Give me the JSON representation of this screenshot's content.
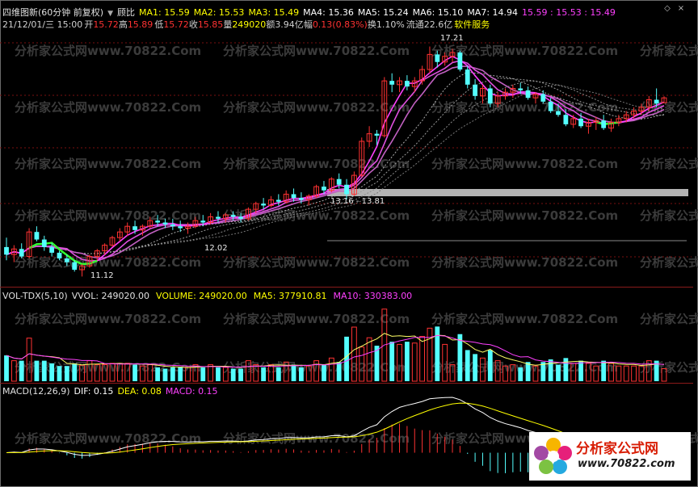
{
  "top_bar": {
    "title": "四维图新(60分钟 前复权)",
    "menu_label": "▼",
    "indicator_name": "顾比",
    "ma": [
      {
        "label": "MA1: 15.59",
        "color": "#ffff00"
      },
      {
        "label": "MA2: 15.53",
        "color": "#ffff00"
      },
      {
        "label": "MA3: 15.49",
        "color": "#ffff00"
      },
      {
        "label": "MA4: 15.36",
        "color": "#ffffff"
      },
      {
        "label": "MA5: 15.24",
        "color": "#ffffff"
      },
      {
        "label": "MA6: 15.10",
        "color": "#ffffff"
      },
      {
        "label": "MA7: 14.94",
        "color": "#ffffff"
      }
    ],
    "extra": "15.59 : 15.53 : 15.49",
    "extra_color": "#ff40ff"
  },
  "quote_bar": {
    "datetime": "21/12/01/三 15:00",
    "open_label": "开",
    "open": "15.72",
    "high_label": "高",
    "high": "15.89",
    "low_label": "低",
    "low": "15.72",
    "close_label": "收",
    "close": "15.85",
    "volume_label": "量",
    "volume": "249020",
    "amount_label": "额",
    "amount": "3.94亿",
    "change_label": "幅",
    "change": "0.13(0.83%)",
    "turnover_label": "换",
    "turnover": "1.10%",
    "float_label": "流通",
    "float": "22.6亿",
    "sector": "软件服务"
  },
  "price_labels": {
    "high_mark": "17.21",
    "mid_mark": "13.16 - 13.81",
    "low_mark": "11.12",
    "partial_mark": "12.02"
  },
  "volume_panel": {
    "name": "VOL-TDX(5,10)",
    "vvol": "VVOL: 249020.00",
    "volume": "VOLUME: 249020.00",
    "ma5": "MA5: 377910.81",
    "ma10": "MA10: 330383.00"
  },
  "macd_panel": {
    "name": "MACD(12,26,9)",
    "dif": "DIF: 0.15",
    "dea": "DEA: 0.08",
    "macd": "MACD: 0.15"
  },
  "watermark": "分析家公式网www.70822.Com",
  "logo": {
    "name": "分析家公式网",
    "url": "www.70822.com"
  },
  "colors": {
    "up": "#ff3232",
    "down": "#54ffff",
    "ma_short": "#ff40ff",
    "ma_long": "#d8d8d8",
    "dif": "#ffffff",
    "dea": "#ffff00",
    "highlight_band": "#b4b4b4"
  },
  "chart_data": {
    "type": "candlestick",
    "price_axis_note": "no printed axis",
    "candles": [
      {
        "o": 11.9,
        "h": 12.15,
        "l": 11.55,
        "c": 11.7
      },
      {
        "o": 11.7,
        "h": 11.95,
        "l": 11.5,
        "c": 11.85
      },
      {
        "o": 11.85,
        "h": 12.0,
        "l": 11.6,
        "c": 11.65
      },
      {
        "o": 11.65,
        "h": 12.4,
        "l": 11.6,
        "c": 12.3
      },
      {
        "o": 12.3,
        "h": 12.45,
        "l": 12.05,
        "c": 12.1
      },
      {
        "o": 12.1,
        "h": 12.2,
        "l": 11.8,
        "c": 11.9
      },
      {
        "o": 11.9,
        "h": 12.0,
        "l": 11.65,
        "c": 11.75
      },
      {
        "o": 11.75,
        "h": 11.8,
        "l": 11.55,
        "c": 11.6
      },
      {
        "o": 11.6,
        "h": 11.7,
        "l": 11.4,
        "c": 11.5
      },
      {
        "o": 11.5,
        "h": 11.55,
        "l": 11.25,
        "c": 11.3
      },
      {
        "o": 11.3,
        "h": 11.45,
        "l": 11.12,
        "c": 11.4
      },
      {
        "o": 11.4,
        "h": 11.7,
        "l": 11.35,
        "c": 11.65
      },
      {
        "o": 11.65,
        "h": 11.85,
        "l": 11.55,
        "c": 11.8
      },
      {
        "o": 11.8,
        "h": 12.0,
        "l": 11.7,
        "c": 11.95
      },
      {
        "o": 11.95,
        "h": 12.2,
        "l": 11.9,
        "c": 12.15
      },
      {
        "o": 12.15,
        "h": 12.4,
        "l": 12.05,
        "c": 12.3
      },
      {
        "o": 12.3,
        "h": 12.55,
        "l": 12.2,
        "c": 12.45
      },
      {
        "o": 12.45,
        "h": 12.6,
        "l": 12.25,
        "c": 12.35
      },
      {
        "o": 12.35,
        "h": 12.5,
        "l": 12.2,
        "c": 12.45
      },
      {
        "o": 12.45,
        "h": 12.7,
        "l": 12.4,
        "c": 12.6
      },
      {
        "o": 12.6,
        "h": 12.75,
        "l": 12.45,
        "c": 12.55
      },
      {
        "o": 12.55,
        "h": 12.65,
        "l": 12.4,
        "c": 12.5
      },
      {
        "o": 12.5,
        "h": 12.65,
        "l": 12.35,
        "c": 12.45
      },
      {
        "o": 12.45,
        "h": 12.6,
        "l": 12.3,
        "c": 12.4
      },
      {
        "o": 12.4,
        "h": 12.55,
        "l": 12.25,
        "c": 12.45
      },
      {
        "o": 12.45,
        "h": 12.7,
        "l": 12.4,
        "c": 12.6
      },
      {
        "o": 12.6,
        "h": 12.75,
        "l": 12.45,
        "c": 12.55
      },
      {
        "o": 12.55,
        "h": 12.8,
        "l": 12.5,
        "c": 12.7
      },
      {
        "o": 12.7,
        "h": 12.85,
        "l": 12.55,
        "c": 12.65
      },
      {
        "o": 12.65,
        "h": 12.8,
        "l": 12.55,
        "c": 12.75
      },
      {
        "o": 12.75,
        "h": 12.85,
        "l": 12.6,
        "c": 12.7
      },
      {
        "o": 12.7,
        "h": 12.8,
        "l": 12.55,
        "c": 12.65
      },
      {
        "o": 12.65,
        "h": 12.95,
        "l": 12.6,
        "c": 12.9
      },
      {
        "o": 12.9,
        "h": 13.1,
        "l": 12.8,
        "c": 13.05
      },
      {
        "o": 13.05,
        "h": 13.2,
        "l": 12.9,
        "c": 13.0
      },
      {
        "o": 13.0,
        "h": 13.25,
        "l": 12.95,
        "c": 13.15
      },
      {
        "o": 13.15,
        "h": 13.3,
        "l": 13.0,
        "c": 13.1
      },
      {
        "o": 13.1,
        "h": 13.4,
        "l": 13.05,
        "c": 13.3
      },
      {
        "o": 13.3,
        "h": 13.45,
        "l": 13.1,
        "c": 13.2
      },
      {
        "o": 13.2,
        "h": 13.35,
        "l": 13.05,
        "c": 13.15
      },
      {
        "o": 13.15,
        "h": 13.3,
        "l": 13.0,
        "c": 13.25
      },
      {
        "o": 13.25,
        "h": 13.55,
        "l": 13.2,
        "c": 13.5
      },
      {
        "o": 13.5,
        "h": 13.65,
        "l": 13.3,
        "c": 13.4
      },
      {
        "o": 13.4,
        "h": 13.75,
        "l": 13.35,
        "c": 13.7
      },
      {
        "o": 13.7,
        "h": 13.85,
        "l": 13.45,
        "c": 13.55
      },
      {
        "o": 13.55,
        "h": 13.7,
        "l": 13.16,
        "c": 13.3
      },
      {
        "o": 13.3,
        "h": 13.9,
        "l": 13.25,
        "c": 13.8
      },
      {
        "o": 13.8,
        "h": 14.8,
        "l": 13.75,
        "c": 14.7
      },
      {
        "o": 14.7,
        "h": 15.1,
        "l": 14.55,
        "c": 14.9
      },
      {
        "o": 14.9,
        "h": 15.0,
        "l": 14.6,
        "c": 14.85
      },
      {
        "o": 14.85,
        "h": 16.4,
        "l": 14.8,
        "c": 16.3
      },
      {
        "o": 16.3,
        "h": 16.5,
        "l": 16.0,
        "c": 16.2
      },
      {
        "o": 16.2,
        "h": 16.4,
        "l": 16.0,
        "c": 16.3
      },
      {
        "o": 16.3,
        "h": 16.45,
        "l": 16.05,
        "c": 16.15
      },
      {
        "o": 16.15,
        "h": 16.4,
        "l": 16.0,
        "c": 16.3
      },
      {
        "o": 16.3,
        "h": 16.7,
        "l": 16.2,
        "c": 16.6
      },
      {
        "o": 16.6,
        "h": 17.21,
        "l": 16.5,
        "c": 17.0
      },
      {
        "o": 17.0,
        "h": 17.1,
        "l": 16.65,
        "c": 16.8
      },
      {
        "o": 16.8,
        "h": 17.05,
        "l": 16.7,
        "c": 16.95
      },
      {
        "o": 16.95,
        "h": 17.15,
        "l": 16.8,
        "c": 17.05
      },
      {
        "o": 17.05,
        "h": 17.1,
        "l": 16.55,
        "c": 16.6
      },
      {
        "o": 16.6,
        "h": 16.7,
        "l": 16.1,
        "c": 16.2
      },
      {
        "o": 16.2,
        "h": 16.35,
        "l": 15.8,
        "c": 15.9
      },
      {
        "o": 15.9,
        "h": 16.2,
        "l": 15.7,
        "c": 16.1
      },
      {
        "o": 16.1,
        "h": 16.2,
        "l": 15.6,
        "c": 15.7
      },
      {
        "o": 15.7,
        "h": 16.0,
        "l": 15.6,
        "c": 15.9
      },
      {
        "o": 15.9,
        "h": 16.1,
        "l": 15.8,
        "c": 16.0
      },
      {
        "o": 16.0,
        "h": 16.2,
        "l": 15.85,
        "c": 16.1
      },
      {
        "o": 16.1,
        "h": 16.25,
        "l": 15.95,
        "c": 16.05
      },
      {
        "o": 16.05,
        "h": 16.15,
        "l": 15.8,
        "c": 15.85
      },
      {
        "o": 15.85,
        "h": 16.0,
        "l": 15.7,
        "c": 15.95
      },
      {
        "o": 15.95,
        "h": 16.05,
        "l": 15.7,
        "c": 15.75
      },
      {
        "o": 15.75,
        "h": 15.85,
        "l": 15.45,
        "c": 15.5
      },
      {
        "o": 15.5,
        "h": 15.7,
        "l": 15.35,
        "c": 15.4
      },
      {
        "o": 15.4,
        "h": 15.55,
        "l": 15.1,
        "c": 15.15
      },
      {
        "o": 15.15,
        "h": 15.4,
        "l": 15.05,
        "c": 15.3
      },
      {
        "o": 15.3,
        "h": 15.45,
        "l": 15.05,
        "c": 15.1
      },
      {
        "o": 15.1,
        "h": 15.3,
        "l": 14.9,
        "c": 15.2
      },
      {
        "o": 15.2,
        "h": 15.35,
        "l": 15.0,
        "c": 15.25
      },
      {
        "o": 15.25,
        "h": 15.4,
        "l": 15.0,
        "c": 15.05
      },
      {
        "o": 15.05,
        "h": 15.3,
        "l": 14.95,
        "c": 15.2
      },
      {
        "o": 15.2,
        "h": 15.4,
        "l": 15.1,
        "c": 15.3
      },
      {
        "o": 15.3,
        "h": 15.5,
        "l": 15.2,
        "c": 15.4
      },
      {
        "o": 15.4,
        "h": 15.6,
        "l": 15.3,
        "c": 15.5
      },
      {
        "o": 15.5,
        "h": 15.7,
        "l": 15.4,
        "c": 15.6
      },
      {
        "o": 15.6,
        "h": 15.9,
        "l": 15.5,
        "c": 15.8
      },
      {
        "o": 15.8,
        "h": 16.1,
        "l": 15.6,
        "c": 15.7
      },
      {
        "o": 15.72,
        "h": 15.89,
        "l": 15.72,
        "c": 15.85
      }
    ],
    "macd_hist_range": [
      -0.45,
      0.55
    ]
  }
}
